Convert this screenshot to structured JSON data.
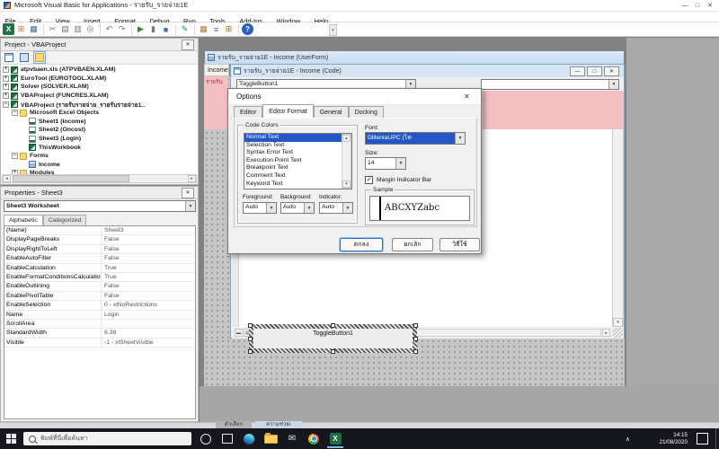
{
  "glyphs": {
    "close": "✕",
    "minimize": "—",
    "maximize": "□",
    "dropdown": "▾",
    "up": "▴",
    "down": "▾",
    "left": "◂",
    "right": "▸",
    "check": "✓",
    "chevron_up": "∧"
  },
  "window": {
    "title": "Microsoft Visual Basic for Applications - รายรับ_รายจ่าย1E"
  },
  "menubar": {
    "items": [
      "File",
      "Edit",
      "View",
      "Insert",
      "Format",
      "Debug",
      "Run",
      "Tools",
      "Add-Ins",
      "Window",
      "Help"
    ]
  },
  "project_panel": {
    "title": "Project - VBAProject",
    "tree": [
      {
        "e": "+",
        "label": "atpvbaen.xls (ATPVBAEN.XLAM)"
      },
      {
        "e": "+",
        "label": "EuroTool (EUROTOOL.XLAM)"
      },
      {
        "e": "+",
        "label": "Solver (SOLVER.XLAM)"
      },
      {
        "e": "+",
        "label": "VBAProject (FUNCRES.XLAM)"
      },
      {
        "e": "−",
        "label": "VBAProject (รายรับรายจ่าย_รายรับรายจ่าย1.."
      },
      {
        "e": "−",
        "label": "Microsoft Excel Objects"
      },
      {
        "e": "",
        "label": "Sheet1 (Income)"
      },
      {
        "e": "",
        "label": "Sheet2 (Oncost)"
      },
      {
        "e": "",
        "label": "Sheet3 (Login)"
      },
      {
        "e": "",
        "label": "ThisWorkbook"
      },
      {
        "e": "−",
        "label": "Forms"
      },
      {
        "e": "",
        "label": "Income"
      },
      {
        "e": "+",
        "label": "Modules"
      }
    ]
  },
  "properties_panel": {
    "title": "Properties - Sheet3",
    "selector": "Sheet3 Worksheet",
    "tab_alphabetic": "Alphabetic",
    "tab_categorized": "Categorized",
    "rows": [
      {
        "key": "(Name)",
        "value": "Sheet3"
      },
      {
        "key": "DisplayPageBreaks",
        "value": "False"
      },
      {
        "key": "DisplayRightToLeft",
        "value": "False"
      },
      {
        "key": "EnableAutoFilter",
        "value": "False"
      },
      {
        "key": "EnableCalculation",
        "value": "True"
      },
      {
        "key": "EnableFormatConditionsCalculation",
        "value": "True"
      },
      {
        "key": "EnableOutlining",
        "value": "False"
      },
      {
        "key": "EnablePivotTable",
        "value": "False"
      },
      {
        "key": "EnableSelection",
        "value": "0 - xlNoRestrictions"
      },
      {
        "key": "Name",
        "value": "Login"
      },
      {
        "key": "ScrollArea",
        "value": ""
      },
      {
        "key": "StandardWidth",
        "value": "8.38"
      },
      {
        "key": "Visible",
        "value": "-1 - xlSheetVisible"
      }
    ]
  },
  "mdi": {
    "userform_window": {
      "title": "รายรับ_รายจ่าย1E - Income (UserForm)",
      "form_caption": "Income",
      "form_label": "รายรับ"
    },
    "code_window": {
      "title": "รายรับ_รายจ่าย1E - Income (Code)",
      "object_combo": "ToggleButton1",
      "procedure_combo": ""
    },
    "toggle_button_label": "ToggleButton1"
  },
  "options_dialog": {
    "title": "Options",
    "tabs": [
      "Editor",
      "Editor Format",
      "General",
      "Docking"
    ],
    "code_colors": {
      "group_label": "Code Colors",
      "items": [
        "Normal Text",
        "Selection Text",
        "Syntax Error Text",
        "Execution Point Text",
        "Breakpoint Text",
        "Comment Text",
        "Keyword Text"
      ],
      "foreground_label": "Foreground:",
      "background_label": "Background:",
      "indicator_label": "Indicator:",
      "foreground_value": "Auto",
      "background_value": "Auto",
      "indicator_value": "Auto"
    },
    "font_label": "Font:",
    "font_value": "DilleniaUPC (ไท",
    "size_label": "Size:",
    "size_value": "14",
    "margin_indicator_label": "Margin Indicator Bar",
    "sample_label": "Sample",
    "sample_text": "ABCXYZabc",
    "buttons": {
      "ok": "ตกลง",
      "cancel": "ยกเลิก",
      "help": "วิธีใช้"
    }
  },
  "background_windows": {
    "tab1": "ตัวเลือก",
    "tab2": "ความช่วยเ"
  },
  "taskbar": {
    "search_placeholder": "พิมพ์ที่นี่เพื่อค้นหา",
    "time": "14:15",
    "date": "21/08/2020"
  },
  "colors": {
    "selection_blue": "#2457c5",
    "form_pink": "#f4bfc3",
    "mdi_gray": "#828282",
    "taskbar_dark": "#16161e"
  }
}
